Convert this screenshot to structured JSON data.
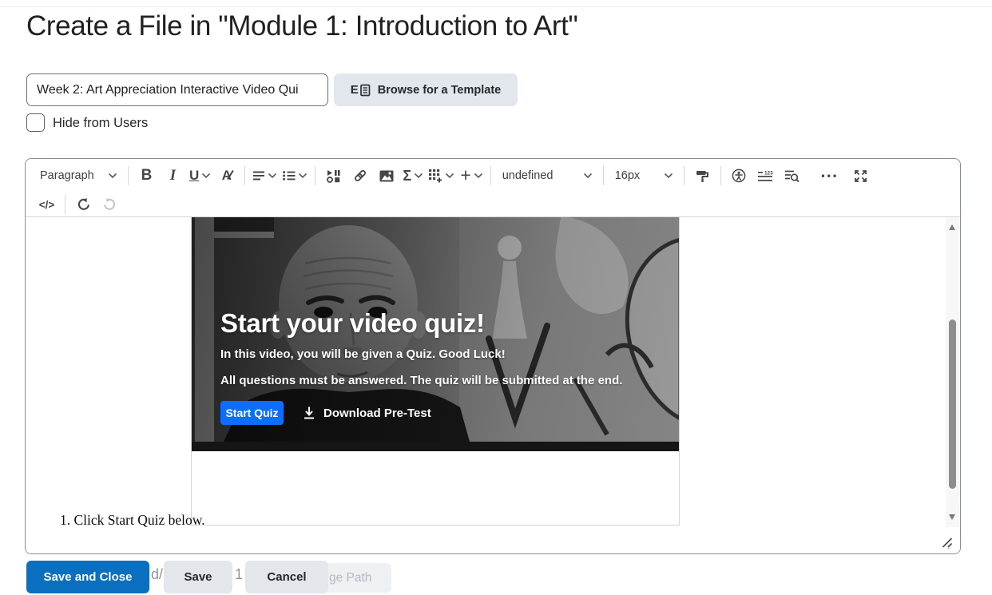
{
  "page": {
    "title": "Create a File in \"Module 1: Introduction to Art\""
  },
  "form": {
    "title_value": "Week 2: Art Appreciation Interactive Video Qui",
    "browse_template_label": "Browse for a Template",
    "hide_from_users_label": "Hide from Users",
    "hide_from_users_checked": false
  },
  "editor": {
    "toolbar": {
      "format_dropdown_value": "Paragraph",
      "font_family_value": "undefined",
      "font_size_value": "16px",
      "glyphs": {
        "bold": "B",
        "italic": "I",
        "underline": "U",
        "font_color": "A",
        "equation": "Σ",
        "insert_plus": "+",
        "more_actions": "⋯",
        "source_code": "</>",
        "word_count_badge": "123"
      },
      "icon_names": [
        "format-dropdown",
        "bold",
        "italic",
        "underline",
        "font-color",
        "align",
        "list",
        "insert-stuff",
        "insert-link",
        "insert-image",
        "equation",
        "table",
        "insert-plus",
        "font-family-dropdown",
        "font-size-dropdown",
        "format-painter",
        "accessibility-checker",
        "word-count",
        "preview",
        "more-actions",
        "fullscreen",
        "source-code",
        "undo",
        "redo"
      ]
    },
    "content": {
      "quiz_embed": {
        "heading": "Start your video quiz!",
        "subline1": "In this video, you will be given a Quiz. Good Luck!",
        "subline2": "All questions must be answered. The quiz will be submitted at the end.",
        "start_quiz_label": "Start Quiz",
        "download_pretest_label": "Download Pre-Test"
      },
      "list_item_1": "1. Click Start Quiz below."
    }
  },
  "footer": {
    "save_and_close_label": "Save and Close",
    "save_label": "Save",
    "cancel_label": "Cancel",
    "obscured_fragments": {
      "fragment_left": "d/",
      "fragment_middle": "1",
      "fragment_right": "ge Path"
    }
  },
  "colors": {
    "primary_action_blue": "#0a6fbe",
    "start_quiz_blue": "#0d6efd",
    "toolbar_icon_gray": "#43474a",
    "heading_text": "#202122"
  }
}
